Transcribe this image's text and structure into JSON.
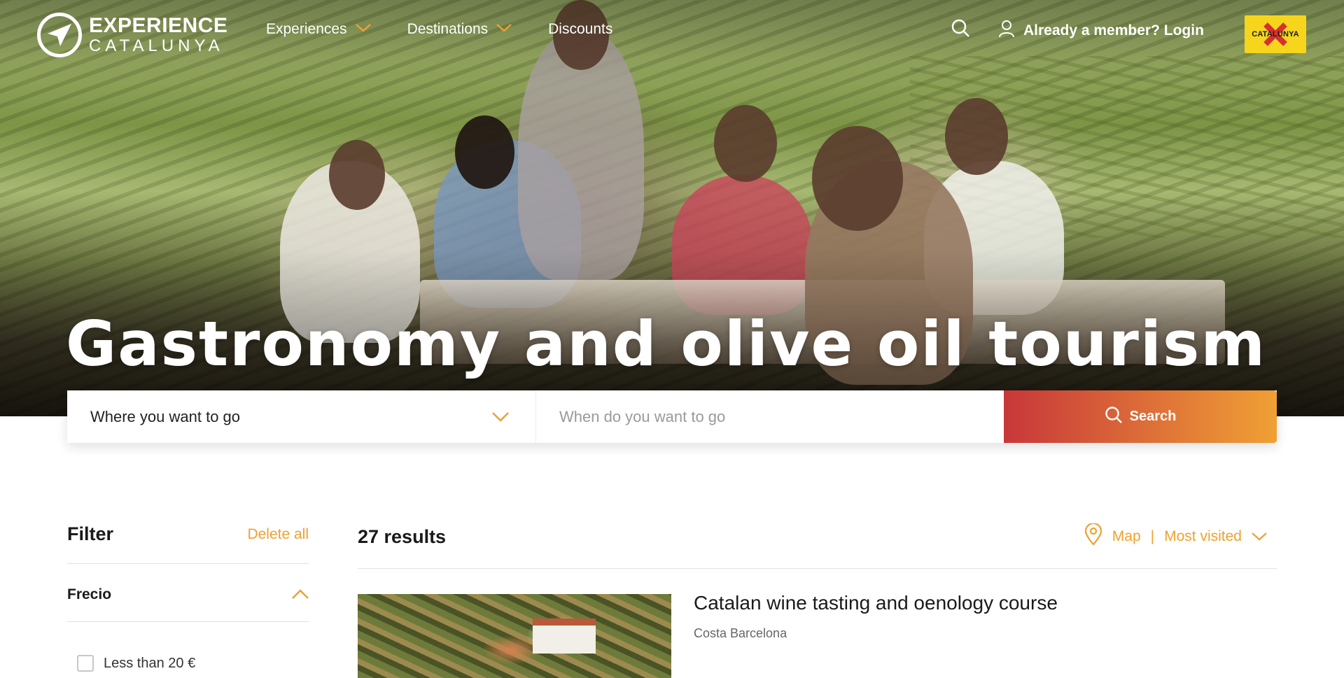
{
  "header": {
    "logo_line1": "EXPERIENCE",
    "logo_line2": "CATALUNYA",
    "nav": [
      {
        "label": "Experiences",
        "has_dropdown": true
      },
      {
        "label": "Destinations",
        "has_dropdown": true
      },
      {
        "label": "Discounts",
        "has_dropdown": false
      }
    ],
    "login_label": "Already a member? Login",
    "brand_badge": "CATALUNYA"
  },
  "hero": {
    "title": "Gastronomy and olive oil tourism"
  },
  "search": {
    "where_placeholder": "Where you want to go",
    "when_placeholder": "When do you want to go",
    "button_label": "Search"
  },
  "filter": {
    "title": "Filter",
    "delete_all": "Delete all",
    "groups": [
      {
        "title": "Frecio",
        "expanded": true
      }
    ],
    "first_option": "Less than 20 €"
  },
  "results": {
    "count_label": "27 results",
    "map_label": "Map",
    "sort_label": "Most visited",
    "items": [
      {
        "title": "Catalan wine tasting and oenology course",
        "location": "Costa Barcelona"
      }
    ]
  },
  "colors": {
    "accent": "#eea12e",
    "button_gradient_start": "#c8373a",
    "button_gradient_end": "#f0a035",
    "brand_yellow": "#f7d51c"
  }
}
